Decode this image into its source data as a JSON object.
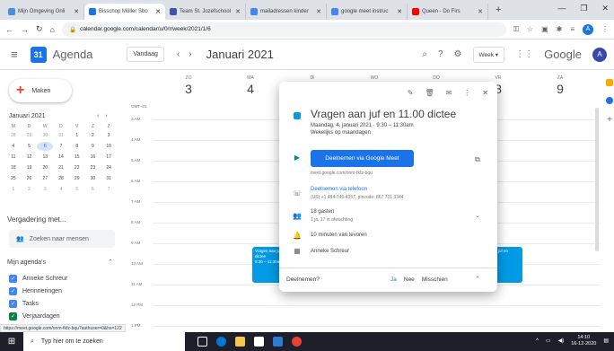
{
  "browser": {
    "tabs": [
      {
        "label": "Mijn Omgeving Onli",
        "color": "#4a90d9"
      },
      {
        "label": "Bisschop Möller Sbo",
        "color": "#1a73e8",
        "active": true
      },
      {
        "label": "Team St. Jozefschool",
        "color": "#3f51b5"
      },
      {
        "label": "mailadressen kinder",
        "color": "#4285f4"
      },
      {
        "label": "google meet instruc",
        "color": "#4285f4"
      },
      {
        "label": "Queen - Do Firs",
        "color": "#ff0000"
      }
    ],
    "url": "calendar.google.com/calendar/u/0/r/week/2021/1/6",
    "profile_initial": "A"
  },
  "header": {
    "app_name": "Agenda",
    "logo_day": "31",
    "today_label": "Vandaag",
    "month_label": "Januari 2021",
    "view_label": "Week",
    "google_label": "Google",
    "avatar_initial": "A"
  },
  "sidebar": {
    "create_label": "Maken",
    "mini_month": "Januari 2021",
    "mini_days_of_week": [
      "M",
      "D",
      "W",
      "D",
      "V",
      "Z",
      "Z"
    ],
    "mini_dates": [
      "28",
      "29",
      "30",
      "31",
      "1",
      "2",
      "3",
      "4",
      "5",
      "6",
      "7",
      "8",
      "9",
      "10",
      "11",
      "12",
      "13",
      "14",
      "15",
      "16",
      "17",
      "18",
      "19",
      "20",
      "21",
      "22",
      "23",
      "24",
      "25",
      "26",
      "27",
      "28",
      "29",
      "30",
      "31",
      "1",
      "2",
      "3",
      "4",
      "5",
      "6",
      "7"
    ],
    "meetings_title": "Vergadering met...",
    "people_search": "Zoeken naar mensen",
    "calendars_title": "Mijn agenda's",
    "calendars": [
      {
        "label": "Anneke Schreur",
        "color": "#4285f4"
      },
      {
        "label": "Herinneringen",
        "color": "#4285f4"
      },
      {
        "label": "Tasks",
        "color": "#4285f4"
      },
      {
        "label": "Verjaardagen",
        "color": "#0b8043"
      }
    ]
  },
  "grid": {
    "gmt": "GMT+01",
    "days": [
      {
        "name": "ZO",
        "date": "3"
      },
      {
        "name": "MA",
        "date": "4"
      },
      {
        "name": "DI",
        "date": "5"
      },
      {
        "name": "WO",
        "date": "6"
      },
      {
        "name": "DO",
        "date": "7"
      },
      {
        "name": "VR",
        "date": "8"
      },
      {
        "name": "ZA",
        "date": "9"
      }
    ],
    "hours": [
      "3 AM",
      "4 AM",
      "5 AM",
      "6 AM",
      "7 AM",
      "8 AM",
      "9 AM",
      "10 AM",
      "11 AM",
      "12 PM",
      "1 PM"
    ],
    "event_title": "Vragen aan juf en 11.00 dictee",
    "event_time": "9:30 – 11:30am",
    "event_title_short": "juf en"
  },
  "popup": {
    "title": "Vragen aan juf en 11.00 dictee",
    "when": "Maandag, 4. januari 2021  ·  9:30 – 11:30am",
    "recurrence": "Wekelijks op maandagen",
    "meet_button": "Deelnemen via Google Meet",
    "meet_link": "meet.google.com/onm-fkfz-bqu",
    "phone_title": "Deelnemen via telefoon",
    "phone_detail": "(US) +1 484-746-4357, pincode: 867 701 3344",
    "guests_title": "18 gasten",
    "guests_detail": "1 ja, 17 in afwachting",
    "reminder": "10 minuten van tevoren",
    "organizer": "Anneke Schreur",
    "rsvp_question": "Deelnemen?",
    "rsvp_yes": "Ja",
    "rsvp_no": "Nee",
    "rsvp_maybe": "Misschien"
  },
  "status_url": "https://meet.google.com/onm-fkfz-bqu?authuser=0&hs=122",
  "taskbar": {
    "search_placeholder": "Typ hier om te zoeken",
    "time": "14:10",
    "date": "16-12-2020"
  }
}
